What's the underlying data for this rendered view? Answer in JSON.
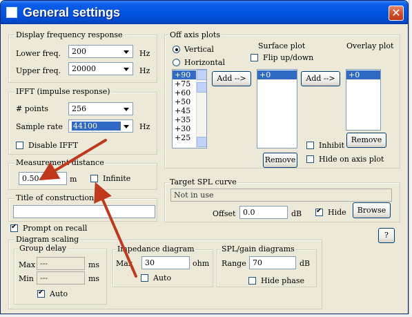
{
  "window": {
    "title": "General settings"
  },
  "display": {
    "legend": "Display frequency response",
    "lower_label": "Lower freq.",
    "lower_value": "200",
    "lower_unit": "Hz",
    "upper_label": "Upper freq.",
    "upper_value": "20000",
    "upper_unit": "Hz"
  },
  "ifft": {
    "legend": "IFFT (impulse response)",
    "points_label": "# points",
    "points_value": "256",
    "rate_label": "Sample rate",
    "rate_value": "44100",
    "rate_unit": "Hz",
    "disable_label": "Disable IFFT"
  },
  "measurement": {
    "legend": "Measurement distance",
    "value": "0.50",
    "unit": "m",
    "infinite_label": "Infinite"
  },
  "construction": {
    "legend": "Title of construction",
    "value": ""
  },
  "off_axis": {
    "legend": "Off axis plots",
    "vertical_label": "Vertical",
    "horizontal_label": "Horizontal",
    "surface_title": "Surface plot",
    "flip_label": "Flip up/down",
    "overlay_title": "Overlay plot",
    "angles": [
      "+90",
      "+75",
      "+60",
      "+50",
      "+45",
      "+35",
      "+30",
      "+25"
    ],
    "add_label": "Add -->",
    "surface_items": [
      "+0"
    ],
    "overlay_items": [
      "+0"
    ],
    "remove_label": "Remove",
    "inhibit_label": "Inhibit",
    "hide_axis_label": "Hide on axis plot"
  },
  "target_spl": {
    "legend": "Target SPL curve",
    "status": "Not in use",
    "offset_label": "Offset",
    "offset_value": "0.0",
    "offset_unit": "dB",
    "hide_label": "Hide",
    "browse_label": "Browse"
  },
  "prompt": {
    "label": "Prompt on recall"
  },
  "help_label": "?",
  "diagram": {
    "legend": "Diagram scaling",
    "group_delay": {
      "legend": "Group delay",
      "max_label": "Max",
      "max_value": "---",
      "min_label": "Min",
      "min_value": "---",
      "unit": "ms",
      "auto_label": "Auto"
    },
    "impedance": {
      "legend": "Impedance diagram",
      "max_label": "Max",
      "max_value": "30",
      "unit": "ohm",
      "auto_label": "Auto"
    },
    "spl": {
      "legend": "SPL/gain diagrams",
      "range_label": "Range",
      "range_value": "70",
      "unit": "dB",
      "hide_phase_label": "Hide phase"
    }
  },
  "colors": {
    "title_bar": "#0054e3",
    "dialog_bg": "#ece9d8",
    "selection": "#316ac5",
    "annotation_arrow": "#c0391c",
    "close_button": "#d4502c"
  },
  "icons": [
    "window-icon",
    "close-icon",
    "dropdown-arrow-icon",
    "scroll-up-icon",
    "scroll-down-icon",
    "annotation-arrow"
  ]
}
